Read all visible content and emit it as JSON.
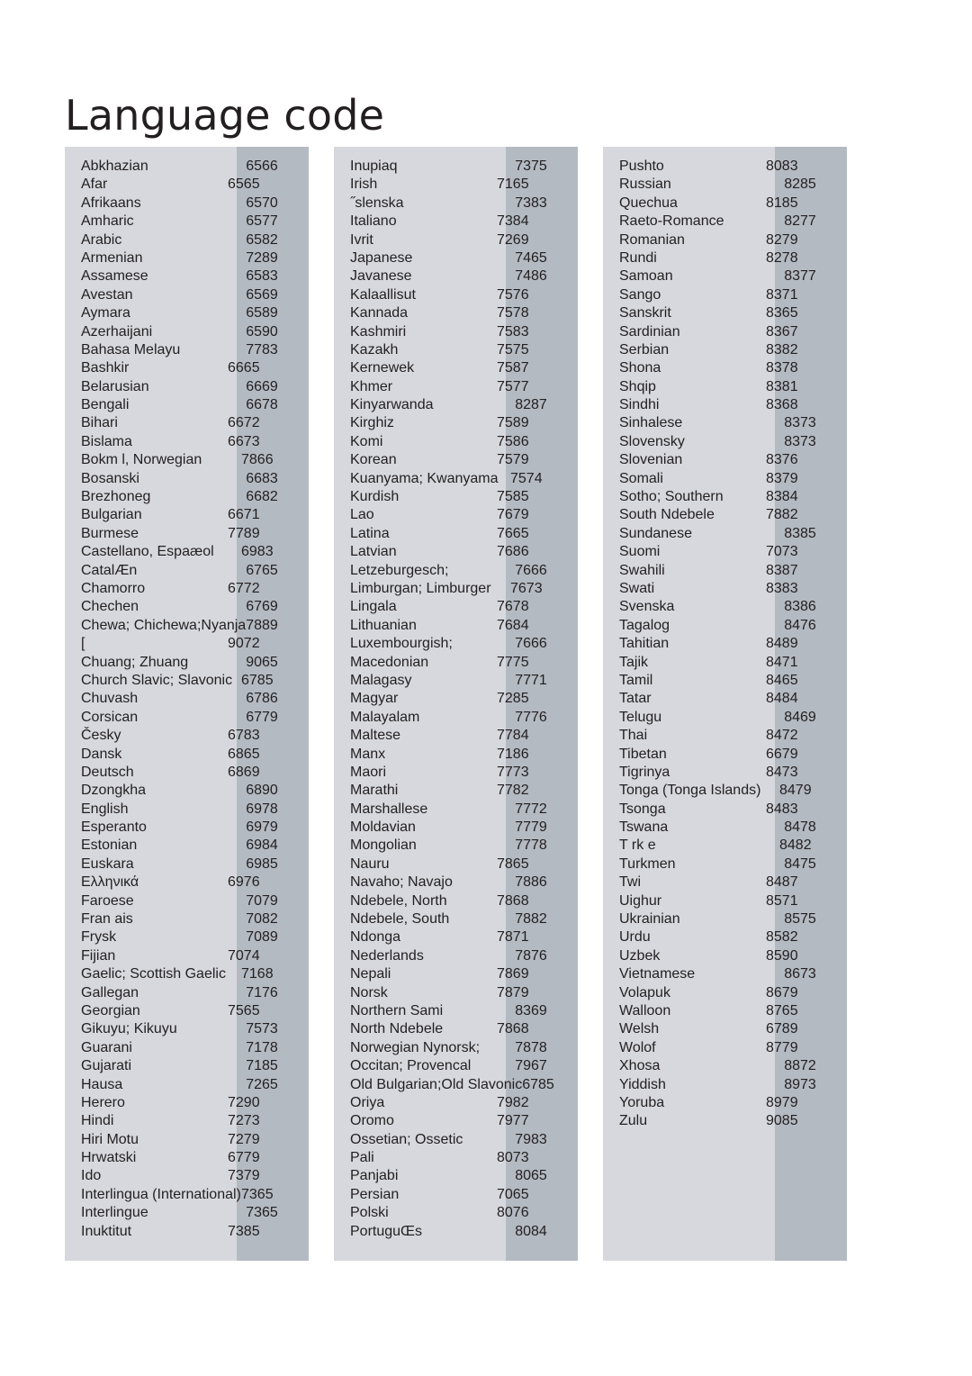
{
  "document": {
    "title": "Language code"
  },
  "table": {
    "columns": [
      {
        "id": "column-1",
        "rows": [
          {
            "name": "Abkhazian",
            "code": "6566"
          },
          {
            "name": "Afar",
            "code": "6565",
            "narrow": true
          },
          {
            "name": "Afrikaans",
            "code": "6570"
          },
          {
            "name": "Amharic",
            "code": "6577"
          },
          {
            "name": "Arabic",
            "code": "6582"
          },
          {
            "name": "Armenian",
            "code": "7289"
          },
          {
            "name": "Assamese",
            "code": "6583"
          },
          {
            "name": "Avestan",
            "code": "6569"
          },
          {
            "name": "Aymara",
            "code": "6589"
          },
          {
            "name": "Azerhaijani",
            "code": "6590"
          },
          {
            "name": "Bahasa Melayu",
            "code": "7783"
          },
          {
            "name": "Bashkir",
            "code": "6665",
            "narrow": true
          },
          {
            "name": "Belarusian",
            "code": "6669"
          },
          {
            "name": "Bengali",
            "code": "6678"
          },
          {
            "name": "Bihari",
            "code": "6672",
            "narrow": true
          },
          {
            "name": "Bislama",
            "code": "6673",
            "narrow": true
          },
          {
            "name": "Bokm l, Norwegian",
            "code": "7866",
            "wide": true
          },
          {
            "name": "Bosanski",
            "code": "6683"
          },
          {
            "name": "Brezhoneg",
            "code": "6682"
          },
          {
            "name": "Bulgarian",
            "code": "6671",
            "narrow": true
          },
          {
            "name": "Burmese",
            "code": "7789",
            "narrow": true
          },
          {
            "name": "Castellano, Espaæol",
            "code": "6983",
            "wide": true
          },
          {
            "name": "CatalÆn",
            "code": "6765"
          },
          {
            "name": "Chamorro",
            "code": "6772",
            "narrow": true
          },
          {
            "name": "Chechen",
            "code": "6769"
          },
          {
            "name": "Chewa; Chichewa;Nyanja",
            "code": "7889",
            "wide": true
          },
          {
            "name": "[",
            "code": "9072",
            "narrow": true
          },
          {
            "name": "Chuang; Zhuang",
            "code": "9065"
          },
          {
            "name": "Church Slavic; Slavonic",
            "code": "6785",
            "wide": true
          },
          {
            "name": "Chuvash",
            "code": "6786"
          },
          {
            "name": "Corsican",
            "code": "6779"
          },
          {
            "name": "Česky",
            "code": "6783",
            "narrow": true
          },
          {
            "name": "Dansk",
            "code": "6865",
            "narrow": true
          },
          {
            "name": "Deutsch",
            "code": "6869",
            "narrow": true
          },
          {
            "name": "Dzongkha",
            "code": "6890"
          },
          {
            "name": "English",
            "code": "6978"
          },
          {
            "name": "Esperanto",
            "code": "6979"
          },
          {
            "name": "Estonian",
            "code": "6984"
          },
          {
            "name": "Euskara",
            "code": "6985"
          },
          {
            "name": "Ελληνικά",
            "code": "6976",
            "narrow": true
          },
          {
            "name": "Faroese",
            "code": "7079"
          },
          {
            "name": "Fran ais",
            "code": "7082"
          },
          {
            "name": "Frysk",
            "code": "7089"
          },
          {
            "name": "Fijian",
            "code": "7074",
            "narrow": true
          },
          {
            "name": "Gaelic; Scottish Gaelic",
            "code": "7168",
            "wide": true
          },
          {
            "name": "Gallegan",
            "code": "7176"
          },
          {
            "name": "Georgian",
            "code": "7565",
            "narrow": true
          },
          {
            "name": "Gikuyu; Kikuyu",
            "code": "7573"
          },
          {
            "name": "Guarani",
            "code": "7178"
          },
          {
            "name": "Gujarati",
            "code": "7185"
          },
          {
            "name": "Hausa",
            "code": "7265"
          },
          {
            "name": "Herero",
            "code": "7290",
            "narrow": true
          },
          {
            "name": "Hindi",
            "code": "7273",
            "narrow": true
          },
          {
            "name": "Hiri Motu",
            "code": "7279",
            "narrow": true
          },
          {
            "name": "Hrwatski",
            "code": "6779",
            "narrow": true
          },
          {
            "name": "Ido",
            "code": "7379",
            "narrow": true
          },
          {
            "name": "Interlingua (International)",
            "code": "7365",
            "wide": true
          },
          {
            "name": "Interlingue",
            "code": "7365"
          },
          {
            "name": "Inuktitut",
            "code": "7385",
            "narrow": true
          }
        ]
      },
      {
        "id": "column-2",
        "rows": [
          {
            "name": "Inupiaq",
            "code": "7375"
          },
          {
            "name": "Irish",
            "code": "7165",
            "narrow": true
          },
          {
            "name": "˝slenska",
            "code": "7383"
          },
          {
            "name": "Italiano",
            "code": "7384",
            "narrow": true
          },
          {
            "name": "Ivrit",
            "code": "7269",
            "narrow": true
          },
          {
            "name": "Japanese",
            "code": "7465"
          },
          {
            "name": "Javanese",
            "code": "7486"
          },
          {
            "name": "Kalaallisut",
            "code": "7576",
            "narrow": true
          },
          {
            "name": "Kannada",
            "code": "7578",
            "narrow": true
          },
          {
            "name": "Kashmiri",
            "code": "7583",
            "narrow": true
          },
          {
            "name": "Kazakh",
            "code": "7575",
            "narrow": true
          },
          {
            "name": "Kernewek",
            "code": "7587",
            "narrow": true
          },
          {
            "name": "Khmer",
            "code": "7577",
            "narrow": true
          },
          {
            "name": "Kinyarwanda",
            "code": "8287"
          },
          {
            "name": "Kirghiz",
            "code": "7589",
            "narrow": true
          },
          {
            "name": "Komi",
            "code": "7586",
            "narrow": true
          },
          {
            "name": "Korean",
            "code": "7579",
            "narrow": true
          },
          {
            "name": "Kuanyama; Kwanyama",
            "code": "7574",
            "wide": true
          },
          {
            "name": "Kurdish",
            "code": "7585",
            "narrow": true
          },
          {
            "name": "Lao",
            "code": "7679",
            "narrow": true
          },
          {
            "name": "Latina",
            "code": "7665",
            "narrow": true
          },
          {
            "name": "Latvian",
            "code": "7686",
            "narrow": true
          },
          {
            "name": "Letzeburgesch;",
            "code": "7666"
          },
          {
            "name": "Limburgan; Limburger",
            "code": "7673",
            "wide": true
          },
          {
            "name": "Lingala",
            "code": "7678",
            "narrow": true
          },
          {
            "name": "Lithuanian",
            "code": "7684",
            "narrow": true
          },
          {
            "name": "Luxembourgish;",
            "code": "7666"
          },
          {
            "name": "Macedonian",
            "code": "7775",
            "narrow": true
          },
          {
            "name": "Malagasy",
            "code": "7771"
          },
          {
            "name": "Magyar",
            "code": "7285",
            "narrow": true
          },
          {
            "name": "Malayalam",
            "code": "7776"
          },
          {
            "name": "Maltese",
            "code": "7784",
            "narrow": true
          },
          {
            "name": "Manx",
            "code": "7186",
            "narrow": true
          },
          {
            "name": "Maori",
            "code": "7773",
            "narrow": true
          },
          {
            "name": "Marathi",
            "code": "7782",
            "narrow": true
          },
          {
            "name": "Marshallese",
            "code": "7772"
          },
          {
            "name": "Moldavian",
            "code": "7779"
          },
          {
            "name": "Mongolian",
            "code": "7778"
          },
          {
            "name": "Nauru",
            "code": "7865",
            "narrow": true
          },
          {
            "name": "Navaho; Navajo",
            "code": "7886"
          },
          {
            "name": "Ndebele, North",
            "code": "7868",
            "narrow": true
          },
          {
            "name": "Ndebele, South",
            "code": "7882"
          },
          {
            "name": "Ndonga",
            "code": "7871",
            "narrow": true
          },
          {
            "name": "Nederlands",
            "code": "7876"
          },
          {
            "name": "Nepali",
            "code": "7869",
            "narrow": true
          },
          {
            "name": "Norsk",
            "code": "7879",
            "narrow": true
          },
          {
            "name": "Northern Sami",
            "code": "8369"
          },
          {
            "name": "North Ndebele",
            "code": "7868",
            "narrow": true
          },
          {
            "name": "Norwegian Nynorsk;",
            "code": "7878"
          },
          {
            "name": "Occitan; Provencal",
            "code": "7967"
          },
          {
            "name": "Old Bulgarian;Old Slavonic",
            "code": "6785",
            "wide": true
          },
          {
            "name": "Oriya",
            "code": "7982",
            "narrow": true
          },
          {
            "name": "Oromo",
            "code": "7977",
            "narrow": true
          },
          {
            "name": "Ossetian; Ossetic",
            "code": "7983"
          },
          {
            "name": "Pali",
            "code": "8073",
            "narrow": true
          },
          {
            "name": "Panjabi",
            "code": "8065"
          },
          {
            "name": "Persian",
            "code": "7065",
            "narrow": true
          },
          {
            "name": "Polski",
            "code": "8076",
            "narrow": true
          },
          {
            "name": "PortuguŒs",
            "code": "8084"
          }
        ]
      },
      {
        "id": "column-3",
        "rows": [
          {
            "name": "Pushto",
            "code": "8083",
            "narrow": true
          },
          {
            "name": "Russian",
            "code": "8285"
          },
          {
            "name": "Quechua",
            "code": "8185",
            "narrow": true
          },
          {
            "name": "Raeto-Romance",
            "code": "8277"
          },
          {
            "name": "Romanian",
            "code": "8279",
            "narrow": true
          },
          {
            "name": "Rundi",
            "code": "8278",
            "narrow": true
          },
          {
            "name": "Samoan",
            "code": "8377"
          },
          {
            "name": "Sango",
            "code": "8371",
            "narrow": true
          },
          {
            "name": "Sanskrit",
            "code": "8365",
            "narrow": true
          },
          {
            "name": "Sardinian",
            "code": "8367",
            "narrow": true
          },
          {
            "name": "Serbian",
            "code": "8382",
            "narrow": true
          },
          {
            "name": "Shona",
            "code": "8378",
            "narrow": true
          },
          {
            "name": "Shqip",
            "code": "8381",
            "narrow": true
          },
          {
            "name": "Sindhi",
            "code": "8368",
            "narrow": true
          },
          {
            "name": "Sinhalese",
            "code": "8373"
          },
          {
            "name": "Slovensky",
            "code": "8373"
          },
          {
            "name": "Slovenian",
            "code": "8376",
            "narrow": true
          },
          {
            "name": "Somali",
            "code": "8379",
            "narrow": true
          },
          {
            "name": "Sotho; Southern",
            "code": "8384",
            "narrow": true
          },
          {
            "name": "South Ndebele",
            "code": "7882",
            "narrow": true
          },
          {
            "name": "Sundanese",
            "code": "8385"
          },
          {
            "name": "Suomi",
            "code": "7073",
            "narrow": true
          },
          {
            "name": "Swahili",
            "code": "8387",
            "narrow": true
          },
          {
            "name": "Swati",
            "code": "8383",
            "narrow": true
          },
          {
            "name": "Svenska",
            "code": "8386"
          },
          {
            "name": "Tagalog",
            "code": "8476"
          },
          {
            "name": "Tahitian",
            "code": "8489",
            "narrow": true
          },
          {
            "name": "Tajik",
            "code": "8471",
            "narrow": true
          },
          {
            "name": "Tamil",
            "code": "8465",
            "narrow": true
          },
          {
            "name": "Tatar",
            "code": "8484",
            "narrow": true
          },
          {
            "name": "Telugu",
            "code": "8469"
          },
          {
            "name": "Thai",
            "code": "8472",
            "narrow": true
          },
          {
            "name": "Tibetan",
            "code": "6679",
            "narrow": true
          },
          {
            "name": "Tigrinya",
            "code": "8473",
            "narrow": true
          },
          {
            "name": "Tonga (Tonga Islands)",
            "code": "8479",
            "wide": true
          },
          {
            "name": "Tsonga",
            "code": "8483",
            "narrow": true
          },
          {
            "name": "Tswana",
            "code": "8478"
          },
          {
            "name": "T rk e",
            "code": "8482",
            "wide": true
          },
          {
            "name": "Turkmen",
            "code": "8475"
          },
          {
            "name": "Twi",
            "code": "8487",
            "narrow": true
          },
          {
            "name": "Uighur",
            "code": "8571",
            "narrow": true
          },
          {
            "name": "Ukrainian",
            "code": "8575"
          },
          {
            "name": "Urdu",
            "code": "8582",
            "narrow": true
          },
          {
            "name": "Uzbek",
            "code": "8590",
            "narrow": true
          },
          {
            "name": "Vietnamese",
            "code": "8673"
          },
          {
            "name": "Volapuk",
            "code": "8679",
            "narrow": true
          },
          {
            "name": "Walloon",
            "code": "8765",
            "narrow": true
          },
          {
            "name": "Welsh",
            "code": "6789",
            "narrow": true
          },
          {
            "name": "Wolof",
            "code": "8779",
            "narrow": true
          },
          {
            "name": "Xhosa",
            "code": "8872"
          },
          {
            "name": "Yiddish",
            "code": "8973"
          },
          {
            "name": "Yoruba",
            "code": "8979",
            "narrow": true
          },
          {
            "name": "Zulu",
            "code": "9085",
            "narrow": true
          }
        ]
      }
    ]
  },
  "colors": {
    "panel_light": "#d6d8dd",
    "panel_code_band": "#b3bac2",
    "text": "#231f20",
    "page_background": "#ffffff"
  }
}
